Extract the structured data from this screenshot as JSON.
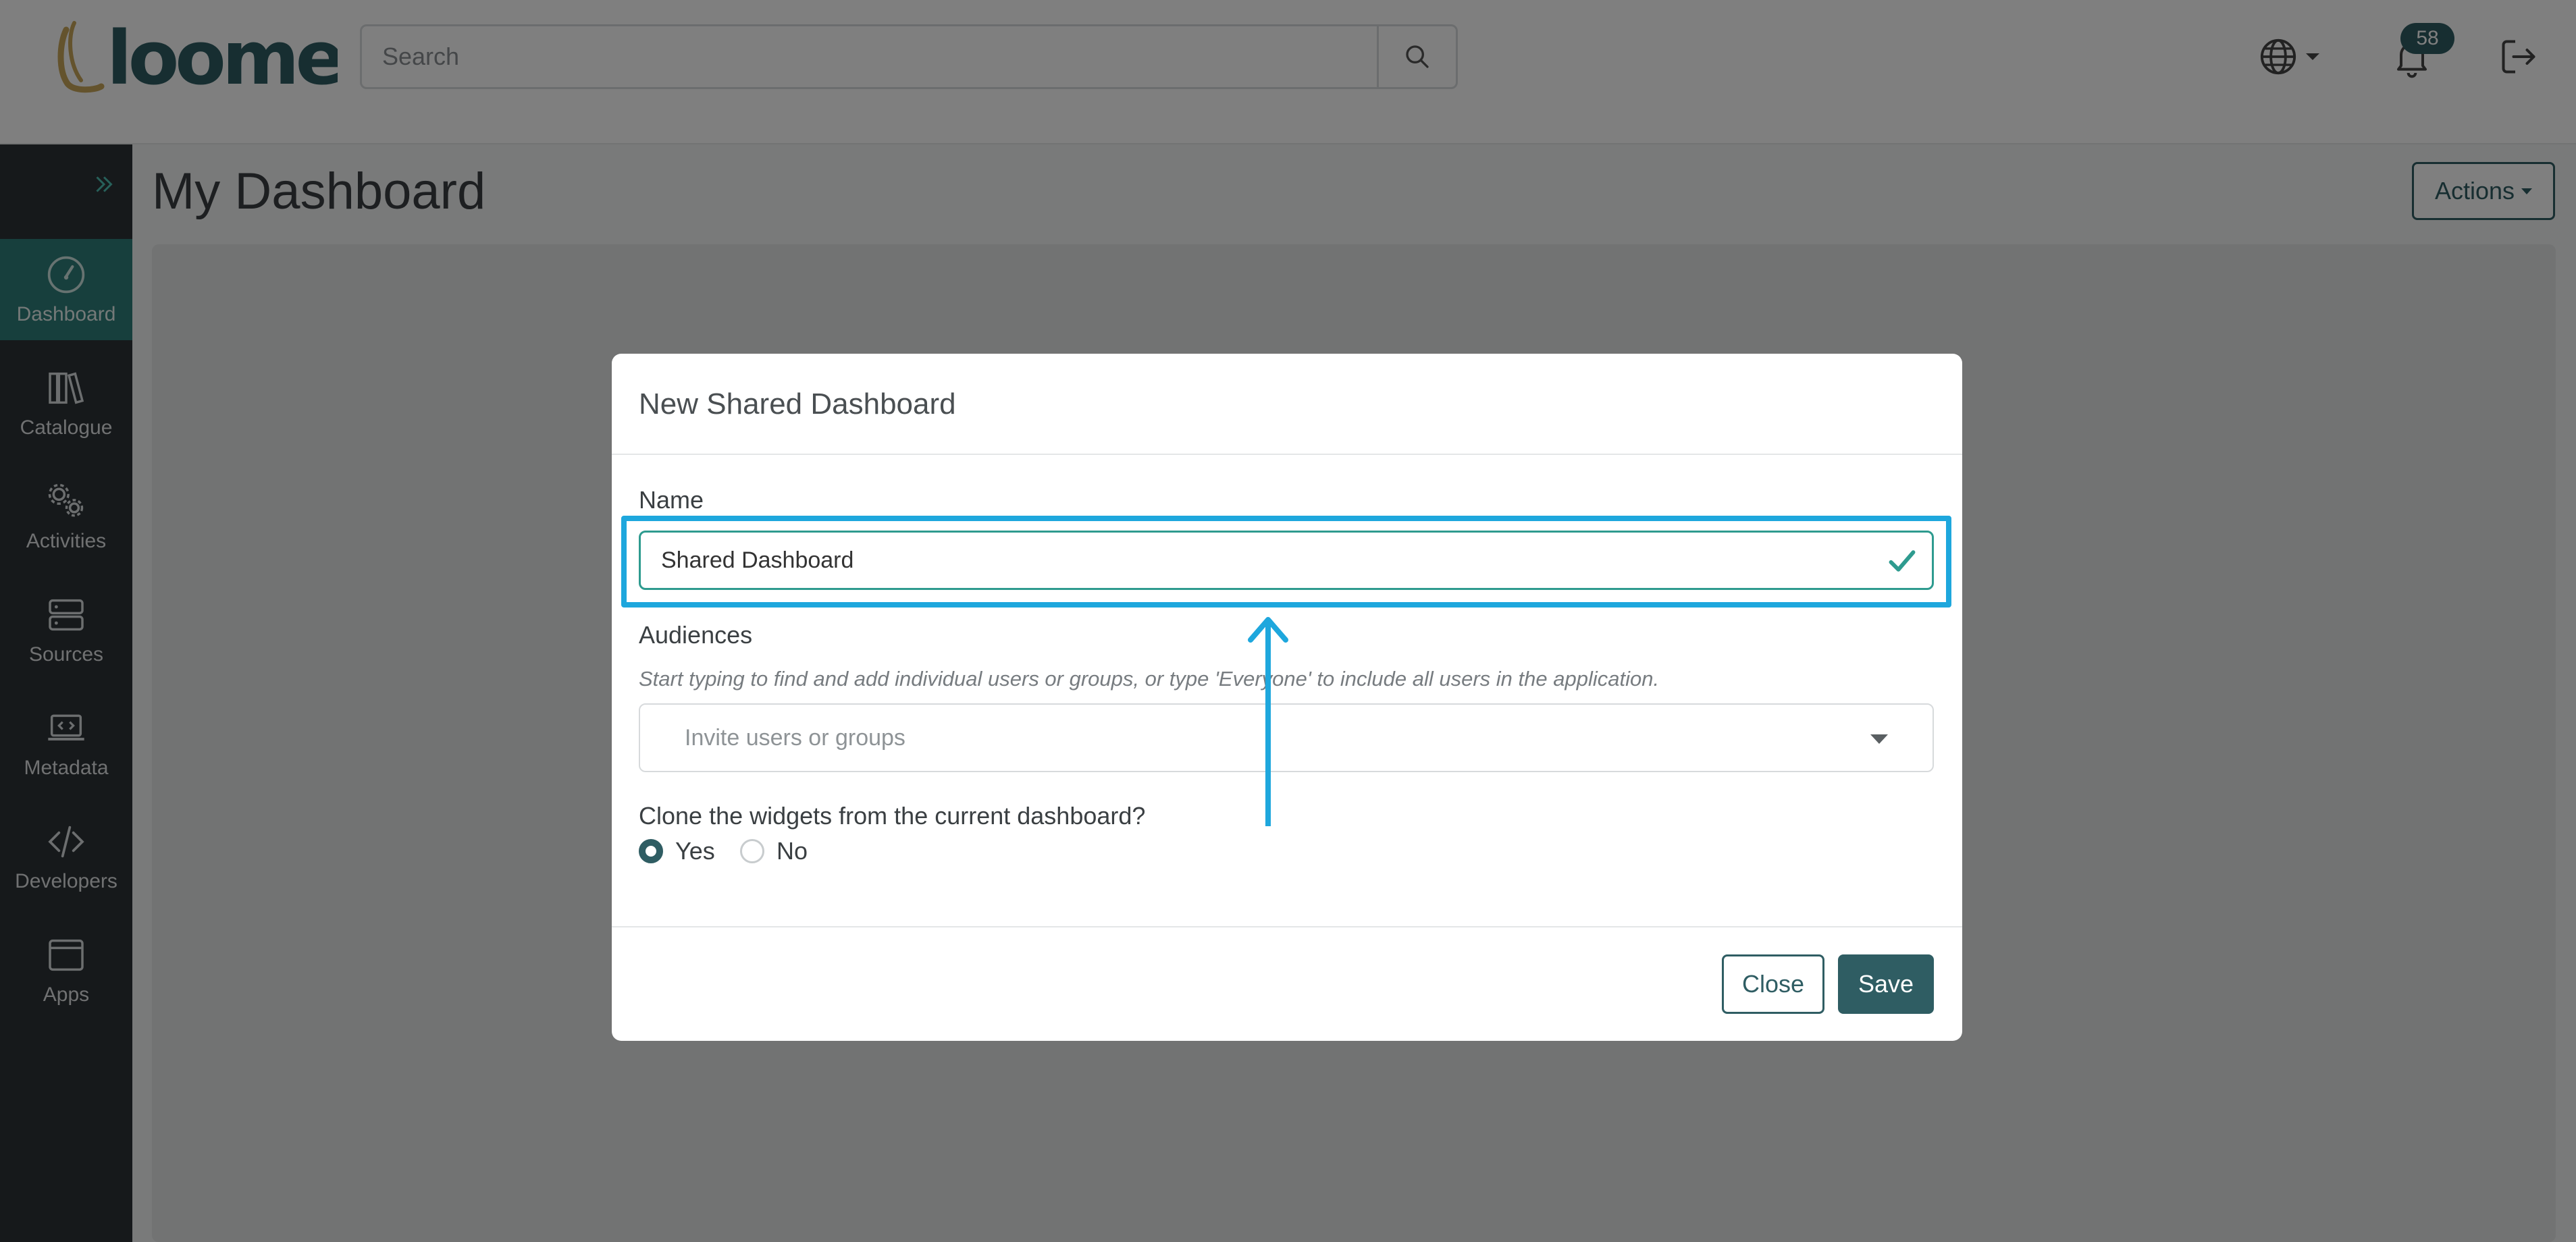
{
  "colors": {
    "accent": "#2f5d63",
    "active_nav": "#2e7f7a",
    "sidebar_bg": "#2c3337",
    "valid_green": "#2e9b8f",
    "annotation_blue": "#1ea7dd"
  },
  "header": {
    "logo_text": "loome",
    "search": {
      "placeholder": "Search",
      "icon": "search-icon"
    },
    "language_icon": "globe-icon",
    "notifications": {
      "icon": "bell-icon",
      "count": "58"
    },
    "logout_icon": "logout-icon"
  },
  "sidebar": {
    "expand_icon": "double-chevron-right-icon",
    "items": [
      {
        "label": "Dashboard",
        "icon": "dashboard-gauge-icon",
        "active": true
      },
      {
        "label": "Catalogue",
        "icon": "books-icon",
        "active": false
      },
      {
        "label": "Activities",
        "icon": "gears-icon",
        "active": false
      },
      {
        "label": "Sources",
        "icon": "server-icon",
        "active": false
      },
      {
        "label": "Metadata",
        "icon": "laptop-code-icon",
        "active": false
      },
      {
        "label": "Developers",
        "icon": "code-icon",
        "active": false
      },
      {
        "label": "Apps",
        "icon": "window-icon",
        "active": false
      }
    ]
  },
  "main": {
    "title": "My Dashboard",
    "actions_label": "Actions"
  },
  "modal": {
    "title": "New Shared Dashboard",
    "name_label": "Name",
    "name_value": "Shared Dashboard",
    "audiences_label": "Audiences",
    "audiences_help": "Start typing to find and add individual users or groups, or type 'Everyone' to include all users in the application.",
    "audiences_placeholder": "Invite users or groups",
    "clone_question": "Clone the widgets from the current dashboard?",
    "clone_options": [
      {
        "label": "Yes",
        "checked": true
      },
      {
        "label": "No",
        "checked": false
      }
    ],
    "close_label": "Close",
    "save_label": "Save"
  }
}
